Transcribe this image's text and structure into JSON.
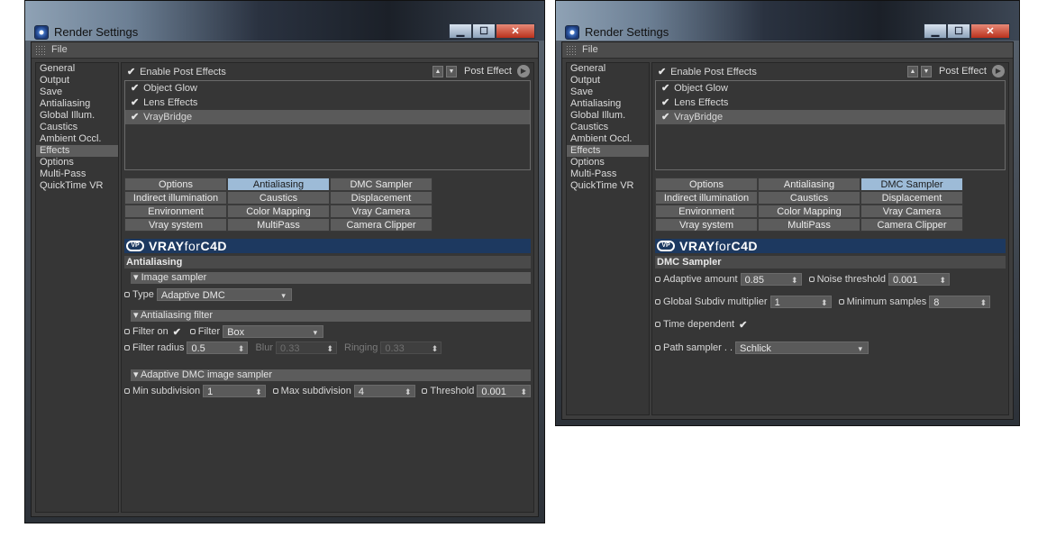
{
  "windows": [
    {
      "title": "Render Settings",
      "menu": "File",
      "sidebar": [
        "General",
        "Output",
        "Save",
        "Antialiasing",
        "Global Illum.",
        "Caustics",
        "Ambient Occl.",
        "Effects",
        "Options",
        "Multi-Pass",
        "QuickTime VR"
      ],
      "active_sidebar": "Effects",
      "enable_post_effects": "Enable Post Effects",
      "post_effect_label": "Post Effect",
      "post_effects": [
        "Object Glow",
        "Lens Effects",
        "VrayBridge"
      ],
      "selected_post_effect": "VrayBridge",
      "tabs": [
        [
          "Options",
          "Antialiasing",
          "DMC Sampler"
        ],
        [
          "Indirect illumination (GI)",
          "Caustics",
          "Displacement"
        ],
        [
          "Environment",
          "Color Mapping",
          "Vray Camera"
        ],
        [
          "Vray system",
          "MultiPass",
          "Camera Clipper"
        ]
      ],
      "active_tab": "Antialiasing",
      "banner_logo": "VRAY for C4D",
      "banner_text_a": "VRAY",
      "banner_text_b": "for",
      "banner_text_c": "C4D",
      "section": "Antialiasing",
      "image_sampler": {
        "group": "▾ Image sampler",
        "type_label": "Type",
        "type_value": "Adaptive DMC"
      },
      "aa_filter": {
        "group": "▾ Antialiasing filter",
        "filter_on_label": "Filter on",
        "filter_on": true,
        "filter_label": "Filter",
        "filter_value": "Box",
        "radius_label": "Filter radius",
        "radius_value": "0.5",
        "blur_label": "Blur",
        "blur_value": "0.33",
        "ringing_label": "Ringing",
        "ringing_value": "0.33"
      },
      "adaptive": {
        "group": "▾ Adaptive DMC image sampler",
        "min_label": "Min subdivision",
        "min_value": "1",
        "max_label": "Max subdivision",
        "max_value": "4",
        "threshold_label": "Threshold",
        "threshold_value": "0.001"
      }
    },
    {
      "title": "Render Settings",
      "menu": "File",
      "sidebar": [
        "General",
        "Output",
        "Save",
        "Antialiasing",
        "Global Illum.",
        "Caustics",
        "Ambient Occl.",
        "Effects",
        "Options",
        "Multi-Pass",
        "QuickTime VR"
      ],
      "active_sidebar": "Effects",
      "enable_post_effects": "Enable Post Effects",
      "post_effect_label": "Post Effect",
      "post_effects": [
        "Object Glow",
        "Lens Effects",
        "VrayBridge"
      ],
      "selected_post_effect": "VrayBridge",
      "tabs": [
        [
          "Options",
          "Antialiasing",
          "DMC Sampler"
        ],
        [
          "Indirect illumination (GI)",
          "Caustics",
          "Displacement"
        ],
        [
          "Environment",
          "Color Mapping",
          "Vray Camera"
        ],
        [
          "Vray system",
          "MultiPass",
          "Camera Clipper"
        ]
      ],
      "active_tab": "DMC Sampler",
      "banner_logo": "VRAY for C4D",
      "banner_text_a": "VRAY",
      "banner_text_b": "for",
      "banner_text_c": "C4D",
      "section": "DMC Sampler",
      "dmc": {
        "adaptive_amount_label": "Adaptive amount",
        "adaptive_amount_value": "0.85",
        "noise_label": "Noise threshold",
        "noise_value": "0.001",
        "gsm_label": "Global Subdiv multiplier",
        "gsm_value": "1",
        "min_samples_label": "Minimum samples",
        "min_samples_value": "8",
        "time_dep_label": "Time dependent",
        "time_dependent": true,
        "path_label": "Path sampler . .",
        "path_value": "Schlick"
      }
    }
  ],
  "icons": {
    "check": "✔",
    "spin": "⬍",
    "dropdown": "▾",
    "minimize": "▁",
    "maximize": "☐",
    "close": "✕"
  },
  "colors": {
    "active_tab": "#9dbbd7",
    "banner": "#1d3960",
    "panel": "#3d3d3d"
  }
}
